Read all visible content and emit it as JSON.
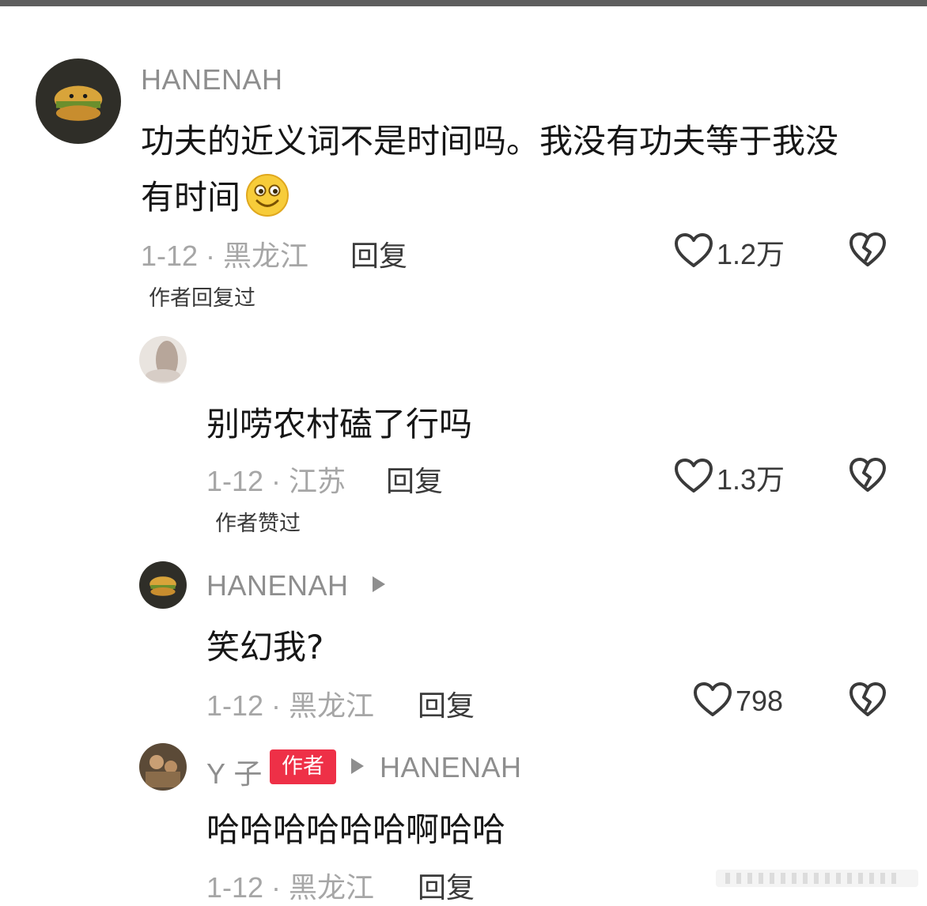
{
  "comments": [
    {
      "username": "HANENAH",
      "text_line1": "功夫的近义词不是时间吗。我没有功夫等于我没",
      "text_line2": "有时间",
      "emoji": "grinning-face-emoji",
      "date_location": "1-12 · 黑龙江",
      "reply_label": "回复",
      "likes": "1.2万",
      "note": "作者回复过"
    },
    {
      "username": "",
      "text": "别唠农村磕了行吗",
      "date_location": "1-12 · 江苏",
      "reply_label": "回复",
      "likes": "1.3万",
      "note": "作者赞过"
    },
    {
      "username": "HANENAH",
      "text": "笑幻我?",
      "date_location": "1-12 · 黑龙江",
      "reply_label": "回复",
      "likes": "798"
    },
    {
      "username": "Y 子",
      "badge": "作者",
      "reply_to": "HANENAH",
      "text": "哈哈哈哈哈哈啊哈哈",
      "date_location": "1-12 · 黑龙江",
      "reply_label": "回复"
    }
  ],
  "icons": {
    "like": "heart-outline-icon",
    "dislike": "broken-heart-icon",
    "reply_arrow": "play-arrow-icon"
  },
  "colors": {
    "author_badge": "#ee3047",
    "username": "#8e8e8e",
    "meta": "#a6a6a6"
  }
}
